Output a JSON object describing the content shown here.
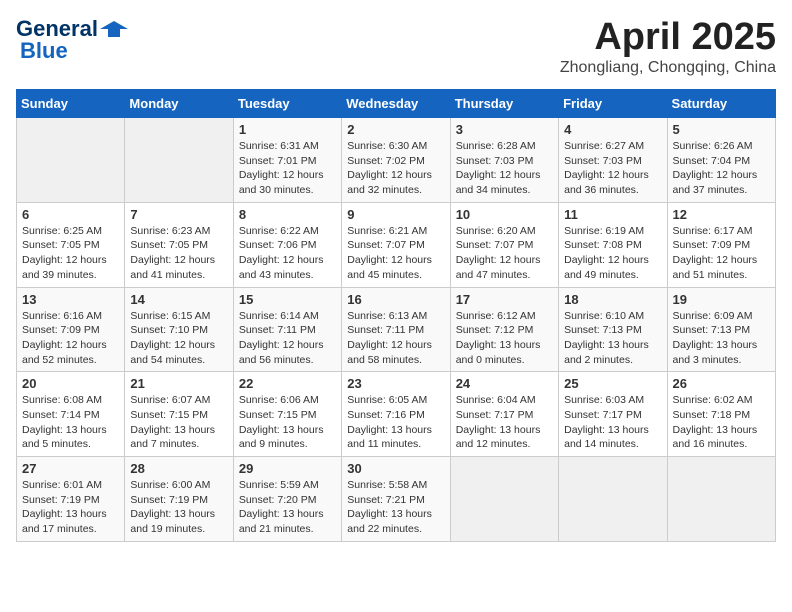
{
  "header": {
    "logo_line1": "General",
    "logo_line2": "Blue",
    "title": "April 2025",
    "subtitle": "Zhongliang, Chongqing, China"
  },
  "weekdays": [
    "Sunday",
    "Monday",
    "Tuesday",
    "Wednesday",
    "Thursday",
    "Friday",
    "Saturday"
  ],
  "weeks": [
    [
      {
        "day": "",
        "text": ""
      },
      {
        "day": "",
        "text": ""
      },
      {
        "day": "1",
        "text": "Sunrise: 6:31 AM\nSunset: 7:01 PM\nDaylight: 12 hours\nand 30 minutes."
      },
      {
        "day": "2",
        "text": "Sunrise: 6:30 AM\nSunset: 7:02 PM\nDaylight: 12 hours\nand 32 minutes."
      },
      {
        "day": "3",
        "text": "Sunrise: 6:28 AM\nSunset: 7:03 PM\nDaylight: 12 hours\nand 34 minutes."
      },
      {
        "day": "4",
        "text": "Sunrise: 6:27 AM\nSunset: 7:03 PM\nDaylight: 12 hours\nand 36 minutes."
      },
      {
        "day": "5",
        "text": "Sunrise: 6:26 AM\nSunset: 7:04 PM\nDaylight: 12 hours\nand 37 minutes."
      }
    ],
    [
      {
        "day": "6",
        "text": "Sunrise: 6:25 AM\nSunset: 7:05 PM\nDaylight: 12 hours\nand 39 minutes."
      },
      {
        "day": "7",
        "text": "Sunrise: 6:23 AM\nSunset: 7:05 PM\nDaylight: 12 hours\nand 41 minutes."
      },
      {
        "day": "8",
        "text": "Sunrise: 6:22 AM\nSunset: 7:06 PM\nDaylight: 12 hours\nand 43 minutes."
      },
      {
        "day": "9",
        "text": "Sunrise: 6:21 AM\nSunset: 7:07 PM\nDaylight: 12 hours\nand 45 minutes."
      },
      {
        "day": "10",
        "text": "Sunrise: 6:20 AM\nSunset: 7:07 PM\nDaylight: 12 hours\nand 47 minutes."
      },
      {
        "day": "11",
        "text": "Sunrise: 6:19 AM\nSunset: 7:08 PM\nDaylight: 12 hours\nand 49 minutes."
      },
      {
        "day": "12",
        "text": "Sunrise: 6:17 AM\nSunset: 7:09 PM\nDaylight: 12 hours\nand 51 minutes."
      }
    ],
    [
      {
        "day": "13",
        "text": "Sunrise: 6:16 AM\nSunset: 7:09 PM\nDaylight: 12 hours\nand 52 minutes."
      },
      {
        "day": "14",
        "text": "Sunrise: 6:15 AM\nSunset: 7:10 PM\nDaylight: 12 hours\nand 54 minutes."
      },
      {
        "day": "15",
        "text": "Sunrise: 6:14 AM\nSunset: 7:11 PM\nDaylight: 12 hours\nand 56 minutes."
      },
      {
        "day": "16",
        "text": "Sunrise: 6:13 AM\nSunset: 7:11 PM\nDaylight: 12 hours\nand 58 minutes."
      },
      {
        "day": "17",
        "text": "Sunrise: 6:12 AM\nSunset: 7:12 PM\nDaylight: 13 hours\nand 0 minutes."
      },
      {
        "day": "18",
        "text": "Sunrise: 6:10 AM\nSunset: 7:13 PM\nDaylight: 13 hours\nand 2 minutes."
      },
      {
        "day": "19",
        "text": "Sunrise: 6:09 AM\nSunset: 7:13 PM\nDaylight: 13 hours\nand 3 minutes."
      }
    ],
    [
      {
        "day": "20",
        "text": "Sunrise: 6:08 AM\nSunset: 7:14 PM\nDaylight: 13 hours\nand 5 minutes."
      },
      {
        "day": "21",
        "text": "Sunrise: 6:07 AM\nSunset: 7:15 PM\nDaylight: 13 hours\nand 7 minutes."
      },
      {
        "day": "22",
        "text": "Sunrise: 6:06 AM\nSunset: 7:15 PM\nDaylight: 13 hours\nand 9 minutes."
      },
      {
        "day": "23",
        "text": "Sunrise: 6:05 AM\nSunset: 7:16 PM\nDaylight: 13 hours\nand 11 minutes."
      },
      {
        "day": "24",
        "text": "Sunrise: 6:04 AM\nSunset: 7:17 PM\nDaylight: 13 hours\nand 12 minutes."
      },
      {
        "day": "25",
        "text": "Sunrise: 6:03 AM\nSunset: 7:17 PM\nDaylight: 13 hours\nand 14 minutes."
      },
      {
        "day": "26",
        "text": "Sunrise: 6:02 AM\nSunset: 7:18 PM\nDaylight: 13 hours\nand 16 minutes."
      }
    ],
    [
      {
        "day": "27",
        "text": "Sunrise: 6:01 AM\nSunset: 7:19 PM\nDaylight: 13 hours\nand 17 minutes."
      },
      {
        "day": "28",
        "text": "Sunrise: 6:00 AM\nSunset: 7:19 PM\nDaylight: 13 hours\nand 19 minutes."
      },
      {
        "day": "29",
        "text": "Sunrise: 5:59 AM\nSunset: 7:20 PM\nDaylight: 13 hours\nand 21 minutes."
      },
      {
        "day": "30",
        "text": "Sunrise: 5:58 AM\nSunset: 7:21 PM\nDaylight: 13 hours\nand 22 minutes."
      },
      {
        "day": "",
        "text": ""
      },
      {
        "day": "",
        "text": ""
      },
      {
        "day": "",
        "text": ""
      }
    ]
  ]
}
